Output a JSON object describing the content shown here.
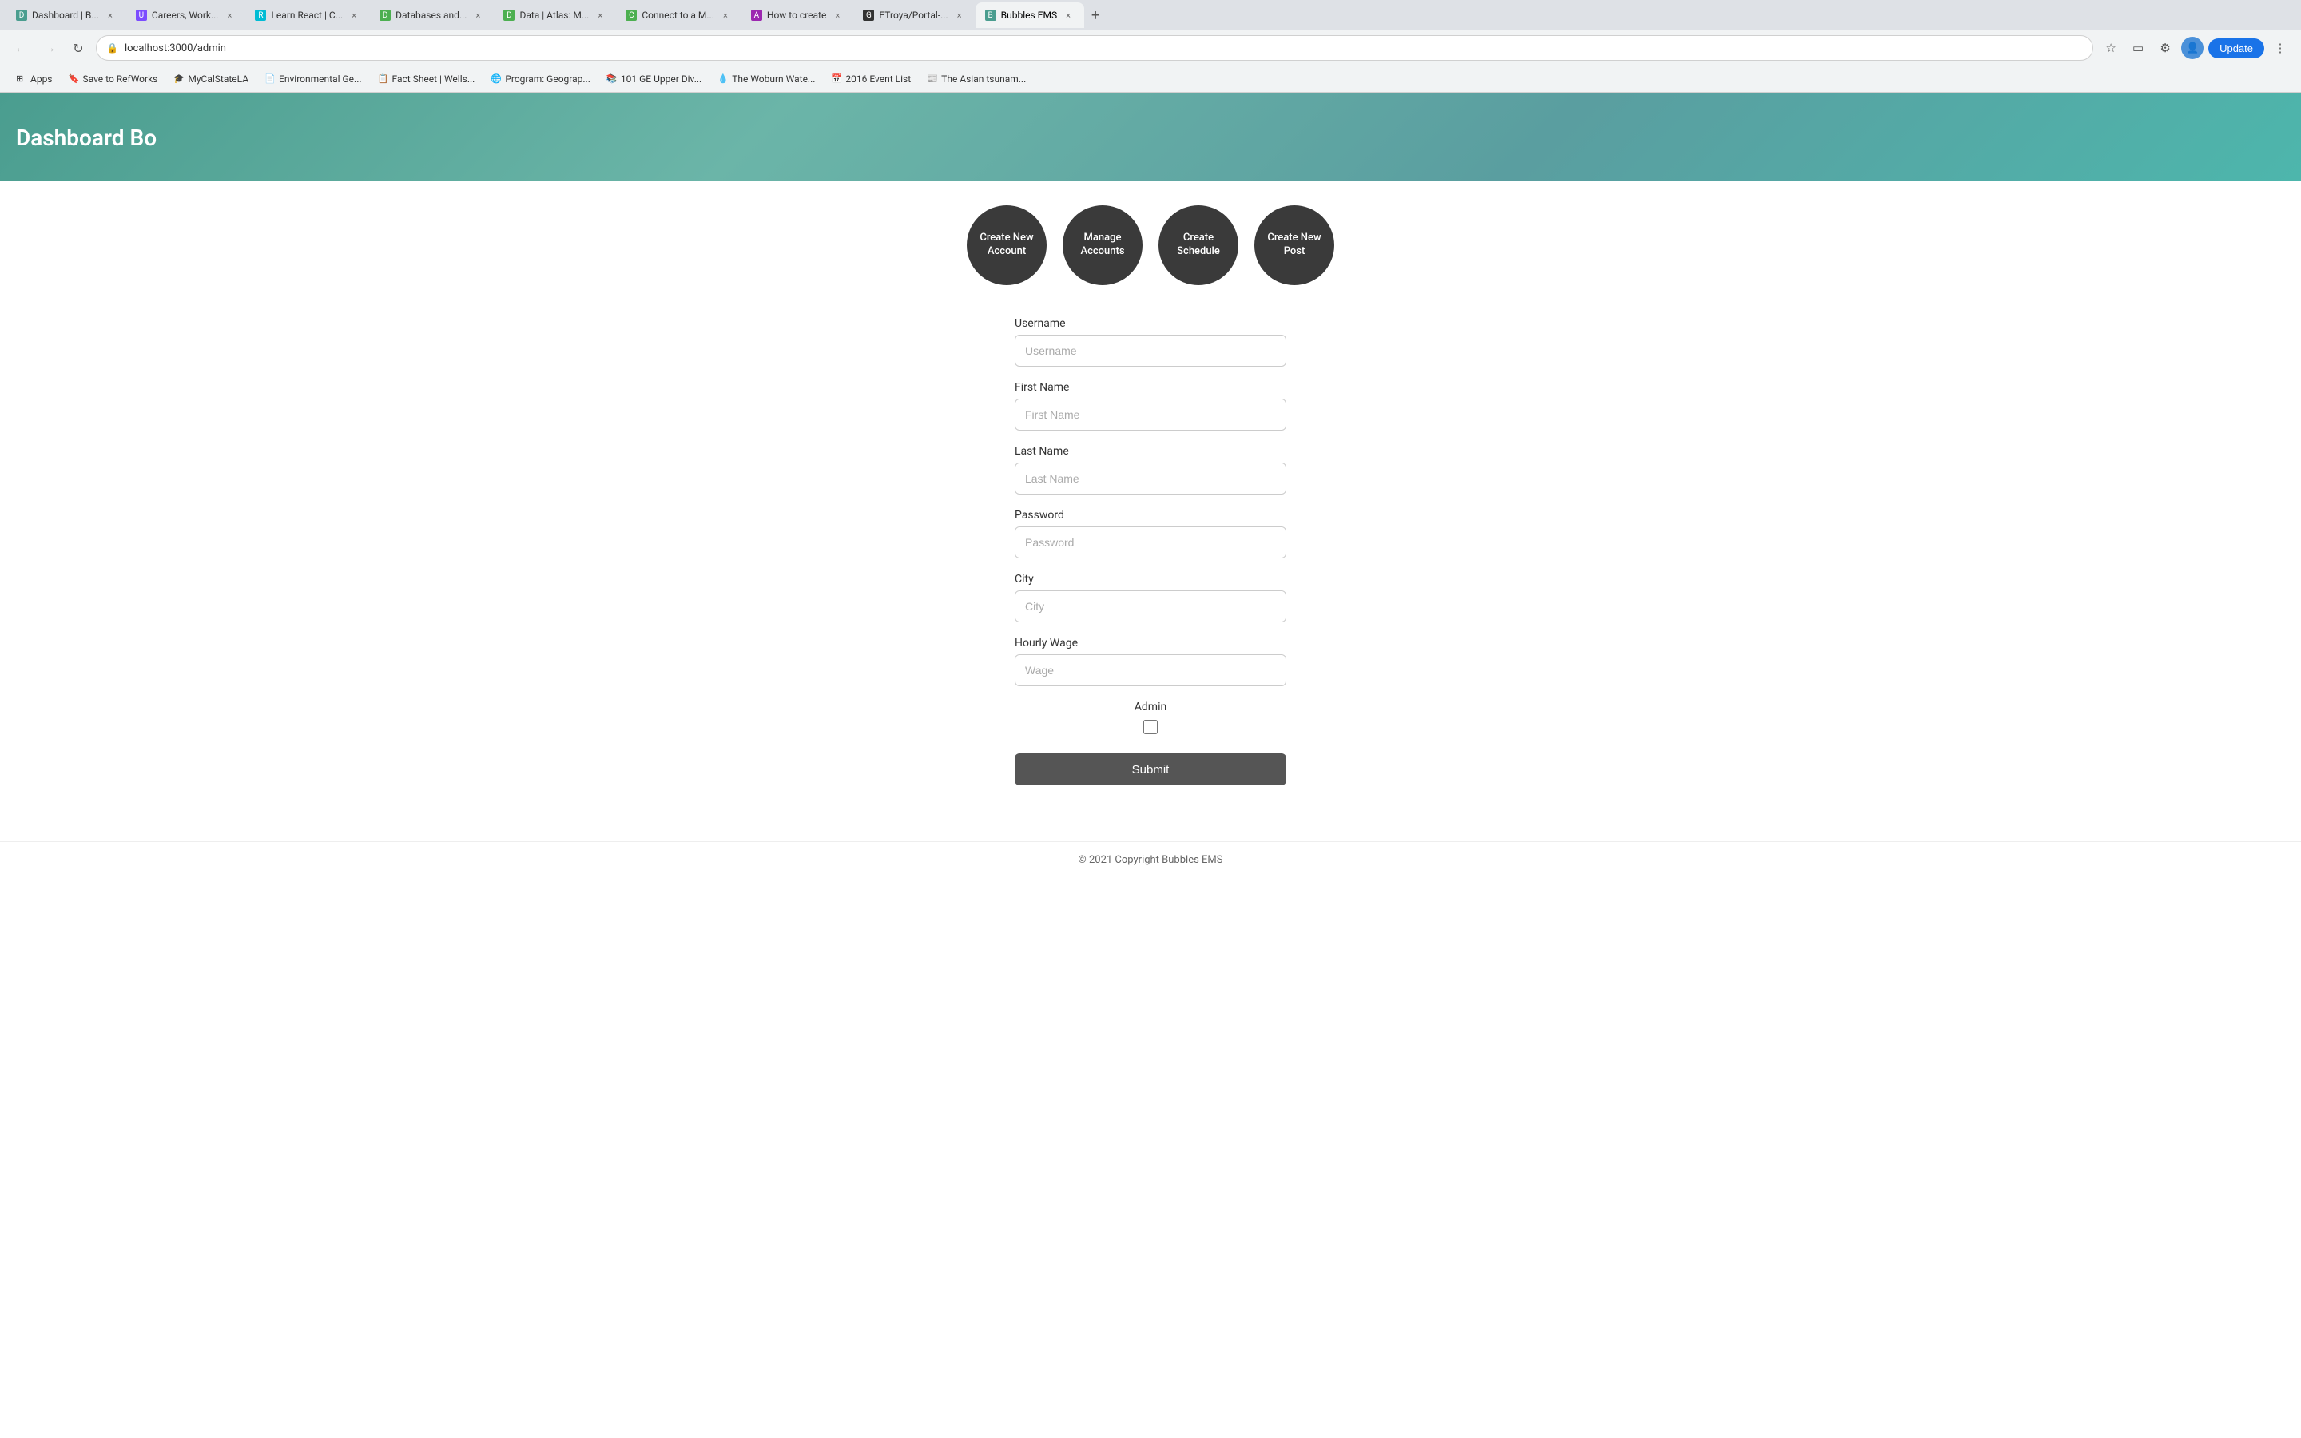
{
  "browser": {
    "tabs": [
      {
        "id": "tab-1",
        "title": "Dashboard | B...",
        "favicon_color": "#4a9d8f",
        "favicon_char": "D",
        "active": false
      },
      {
        "id": "tab-2",
        "title": "Careers, Work...",
        "favicon_color": "#7c4dff",
        "favicon_char": "U",
        "active": false
      },
      {
        "id": "tab-3",
        "title": "Learn React | C...",
        "favicon_color": "#00bcd4",
        "favicon_char": "R",
        "active": false
      },
      {
        "id": "tab-4",
        "title": "Databases and...",
        "favicon_color": "#4caf50",
        "favicon_char": "D",
        "active": false
      },
      {
        "id": "tab-5",
        "title": "Data | Atlas: M...",
        "favicon_color": "#4caf50",
        "favicon_char": "D",
        "active": false
      },
      {
        "id": "tab-6",
        "title": "Connect to a M...",
        "favicon_color": "#4caf50",
        "favicon_char": "C",
        "active": false
      },
      {
        "id": "tab-7",
        "title": "How to create",
        "favicon_color": "#9c27b0",
        "favicon_char": "A",
        "active": false
      },
      {
        "id": "tab-8",
        "title": "ETroya/Portal-...",
        "favicon_color": "#333",
        "favicon_char": "G",
        "active": false
      },
      {
        "id": "tab-9",
        "title": "Bubbles EMS",
        "favicon_color": "#4a9d8f",
        "favicon_char": "B",
        "active": true
      }
    ],
    "address": "localhost:3000/admin",
    "update_label": "Update"
  },
  "bookmarks": [
    {
      "id": "bm-1",
      "label": "Apps",
      "favicon": "⊞"
    },
    {
      "id": "bm-2",
      "label": "Save to RefWorks",
      "favicon": "🔖"
    },
    {
      "id": "bm-3",
      "label": "MyCalStateLA",
      "favicon": "🎓"
    },
    {
      "id": "bm-4",
      "label": "Environmental Ge...",
      "favicon": "📄"
    },
    {
      "id": "bm-5",
      "label": "Fact Sheet | Wells...",
      "favicon": "📋"
    },
    {
      "id": "bm-6",
      "label": "Program: Geograp...",
      "favicon": "🌐"
    },
    {
      "id": "bm-7",
      "label": "101 GE Upper Div...",
      "favicon": "📚"
    },
    {
      "id": "bm-8",
      "label": "The Woburn Wate...",
      "favicon": "💧"
    },
    {
      "id": "bm-9",
      "label": "2016 Event List",
      "favicon": "📅"
    },
    {
      "id": "bm-10",
      "label": "The Asian tsunam...",
      "favicon": "📰"
    }
  ],
  "header": {
    "title": "Dashboard Bo"
  },
  "nav_circles": [
    {
      "id": "nav-create-account",
      "label": "Create\nNew\nAccount"
    },
    {
      "id": "nav-manage-accounts",
      "label": "Manage\nAccounts"
    },
    {
      "id": "nav-create-schedule",
      "label": "Create\nSchedule"
    },
    {
      "id": "nav-create-post",
      "label": "Create\nNew Post"
    }
  ],
  "form": {
    "fields": [
      {
        "id": "username",
        "label": "Username",
        "placeholder": "Username",
        "type": "text"
      },
      {
        "id": "first-name",
        "label": "First Name",
        "placeholder": "First Name",
        "type": "text"
      },
      {
        "id": "last-name",
        "label": "Last Name",
        "placeholder": "Last Name",
        "type": "text"
      },
      {
        "id": "password",
        "label": "Password",
        "placeholder": "Password",
        "type": "password"
      },
      {
        "id": "city",
        "label": "City",
        "placeholder": "City",
        "type": "text"
      },
      {
        "id": "hourly-wage",
        "label": "Hourly Wage",
        "placeholder": "Wage",
        "type": "text"
      }
    ],
    "admin_label": "Admin",
    "submit_label": "Submit"
  },
  "footer": {
    "text": "© 2021 Copyright Bubbles EMS"
  }
}
